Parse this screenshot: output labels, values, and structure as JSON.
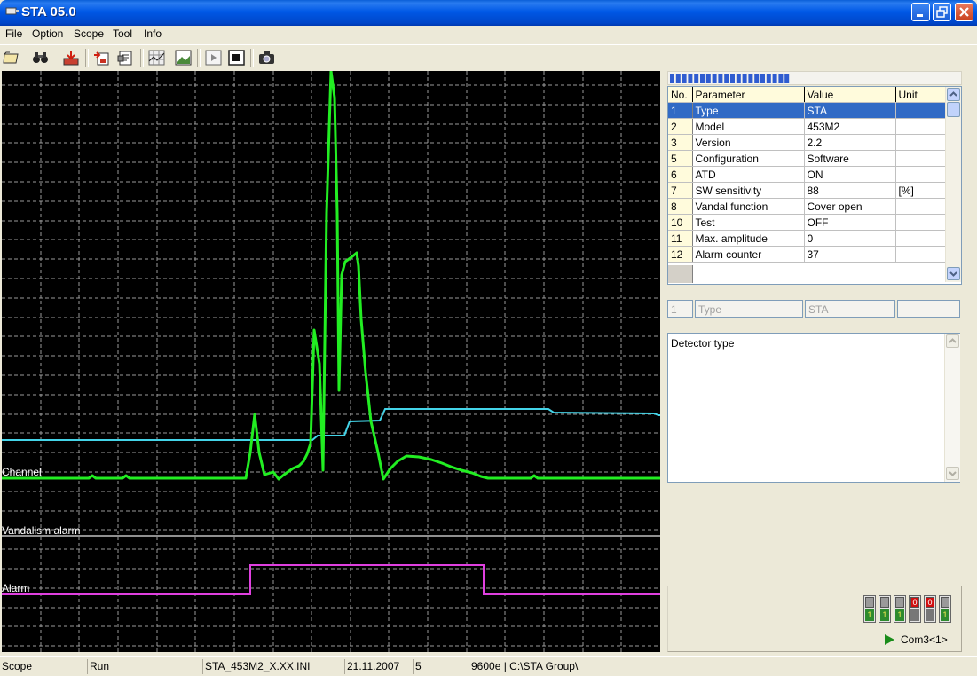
{
  "window": {
    "title": "STA 05.0"
  },
  "menu": {
    "items": [
      "File",
      "Option",
      "Scope",
      "Tool",
      "Info"
    ]
  },
  "toolbar": {
    "icons": [
      "open-icon",
      "binoculars-icon",
      "download-icon",
      "upload-icon",
      "properties-icon",
      "grid-settings-icon",
      "image-icon",
      "play-icon",
      "stop-icon",
      "camera-icon"
    ]
  },
  "scope": {
    "channel_label": "Channel",
    "vandalism_label": "Vandalism alarm",
    "alarm_label": "Alarm",
    "colors": {
      "background": "#000000",
      "grid": "#9a9a9a",
      "channel": "#22ee22",
      "reference": "#44d4e8",
      "vandalism": "#c0c0c0",
      "alarm": "#e040e0"
    }
  },
  "grid": {
    "headers": [
      "No.",
      "Parameter",
      "Value",
      "Unit"
    ],
    "rows": [
      {
        "no": "1",
        "parameter": "Type",
        "value": "STA",
        "unit": "",
        "selected": true
      },
      {
        "no": "2",
        "parameter": "Model",
        "value": "453M2",
        "unit": ""
      },
      {
        "no": "3",
        "parameter": "Version",
        "value": "2.2",
        "unit": ""
      },
      {
        "no": "5",
        "parameter": "Configuration",
        "value": "Software",
        "unit": ""
      },
      {
        "no": "6",
        "parameter": "ATD",
        "value": "ON",
        "unit": ""
      },
      {
        "no": "7",
        "parameter": "SW sensitivity",
        "value": "88",
        "unit": "[%]"
      },
      {
        "no": "8",
        "parameter": "Vandal function",
        "value": "Cover open",
        "unit": ""
      },
      {
        "no": "10",
        "parameter": "Test",
        "value": "OFF",
        "unit": ""
      },
      {
        "no": "11",
        "parameter": "Max. amplitude",
        "value": "0",
        "unit": ""
      },
      {
        "no": "12",
        "parameter": "Alarm counter",
        "value": "37",
        "unit": ""
      }
    ]
  },
  "editor": {
    "no": "1",
    "parameter": "Type",
    "value": "STA",
    "unit": ""
  },
  "description": {
    "text": "Detector type"
  },
  "status_panel": {
    "switches": [
      {
        "state": "1",
        "color": "green"
      },
      {
        "state": "1",
        "color": "green"
      },
      {
        "state": "1",
        "color": "green"
      },
      {
        "state": "0",
        "color": "red"
      },
      {
        "state": "0",
        "color": "red"
      },
      {
        "state": "1",
        "color": "green"
      }
    ],
    "com_label": "Com3<1>"
  },
  "statusbar": {
    "mode": "Scope",
    "state": "Run",
    "file": "STA_453M2_X.XX.INI",
    "date": "21.11.2007",
    "count": "5",
    "port_path": "9600e | C:\\STA Group\\"
  }
}
